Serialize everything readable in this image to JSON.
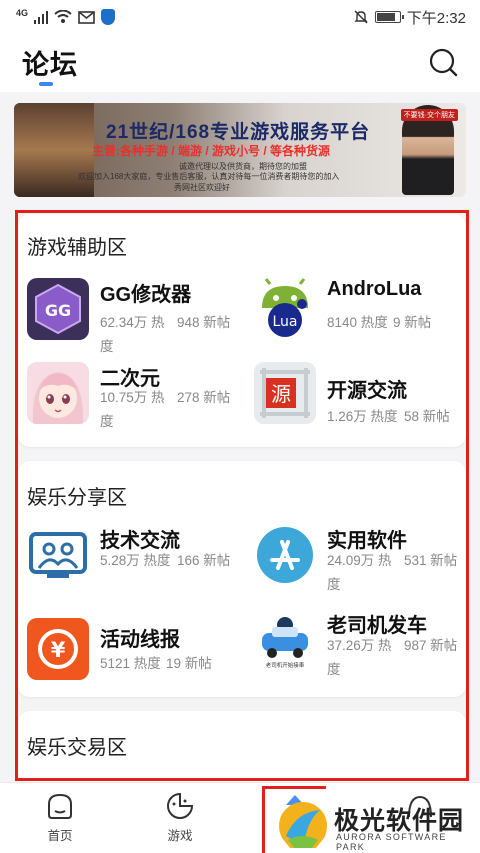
{
  "status_bar": {
    "signal_label": "4G",
    "time": "下午2:32",
    "battery_level": 0.85
  },
  "header": {
    "title": "论坛"
  },
  "banner": {
    "title": "21世纪/168专业游戏服务平台",
    "subtitle": "主营:各种手游 / 端游 / 游戏小号 / 等各种货源",
    "line1": "诚邀代理以及供货商，期待您的加盟",
    "line2": "欢迎加入168大家庭，专业售后客服，认真对待每一位消费者期待您的加入",
    "line3": "秀网社区欢迎好",
    "tag": "不要钱·交个朋友"
  },
  "sections": [
    {
      "title": "游戏辅助区",
      "items": [
        {
          "name": "GG修改器",
          "heat": "62.34万 热度",
          "posts": "948 新帖",
          "icon": "gg-modifier-icon"
        },
        {
          "name": "AndroLua",
          "heat": "8140 热度",
          "posts": "9 新帖",
          "icon": "androlua-icon",
          "icon_text": "Lua"
        },
        {
          "name": "二次元",
          "heat": "10.75万 热度",
          "posts": "278 新帖",
          "icon": "anime-girl-icon"
        },
        {
          "name": "开源交流",
          "heat": "1.26万 热度",
          "posts": "58 新帖",
          "icon": "open-source-icon",
          "icon_text": "源"
        }
      ]
    },
    {
      "title": "娱乐分享区",
      "items": [
        {
          "name": "技术交流",
          "heat": "5.28万 热度",
          "posts": "166 新帖",
          "icon": "people-icon"
        },
        {
          "name": "实用软件",
          "heat": "24.09万 热度",
          "posts": "531 新帖",
          "icon": "app-store-icon"
        },
        {
          "name": "活动线报",
          "heat": "5121 热度",
          "posts": "19 新帖",
          "icon": "yen-icon",
          "icon_text": "¥"
        },
        {
          "name": "老司机发车",
          "heat": "37.26万 热度",
          "posts": "987 新帖",
          "icon": "car-icon",
          "icon_text": "老司机开始接車"
        }
      ]
    },
    {
      "title": "娱乐交易区"
    }
  ],
  "bottom_nav": [
    {
      "label": "首页",
      "icon": "home-icon"
    },
    {
      "label": "游戏",
      "icon": "game-icon"
    },
    {
      "label": "",
      "icon": "forum-icon"
    },
    {
      "label": "",
      "icon": "profile-icon"
    }
  ],
  "watermark": {
    "name": "极光软件园",
    "subtitle": "AURORA SOFTWARE PARK"
  },
  "colors": {
    "accent": "#3d86f0",
    "highlight_frame": "#e0211a",
    "background": "#f4f4f6"
  }
}
